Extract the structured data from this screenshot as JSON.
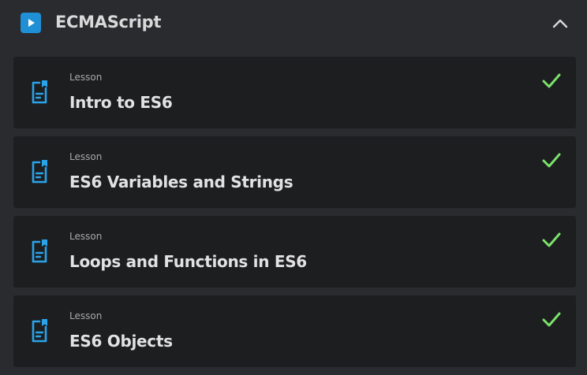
{
  "section": {
    "title": "ECMAScript",
    "play_icon": "play-icon",
    "collapse_icon": "chevron-up-icon",
    "accent_color": "#1f8fd6",
    "complete_color": "#7be36a"
  },
  "lessons": [
    {
      "type": "Lesson",
      "title": "Intro to ES6",
      "icon": "lesson-document-icon",
      "status_icon": "checkmark-icon"
    },
    {
      "type": "Lesson",
      "title": "ES6 Variables and Strings",
      "icon": "lesson-document-icon",
      "status_icon": "checkmark-icon"
    },
    {
      "type": "Lesson",
      "title": "Loops and Functions in ES6",
      "icon": "lesson-document-icon",
      "status_icon": "checkmark-icon"
    },
    {
      "type": "Lesson",
      "title": "ES6 Objects",
      "icon": "lesson-document-icon",
      "status_icon": "checkmark-icon"
    }
  ]
}
